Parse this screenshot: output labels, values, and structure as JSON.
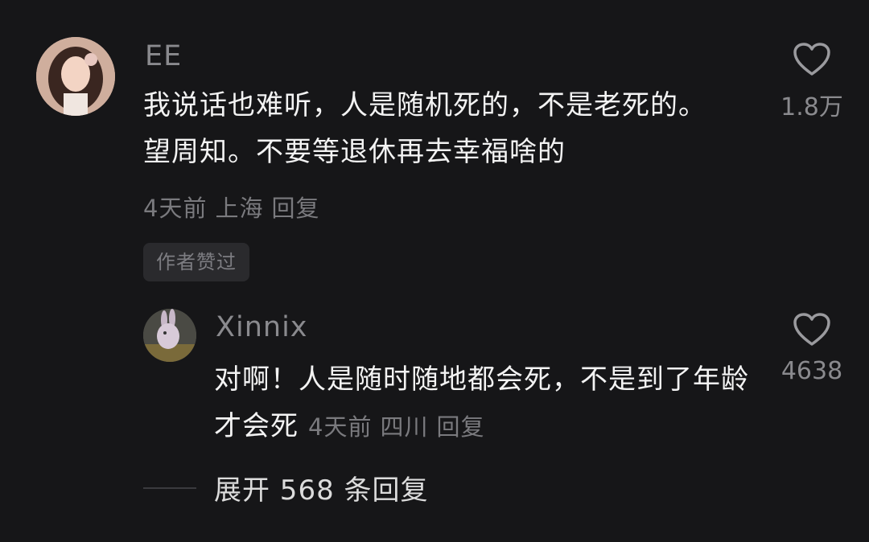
{
  "comment": {
    "author": "EE",
    "text": "我说话也难听，人是随机死的，不是老死的。望周知。不要等退休再去幸福啥的",
    "time": "4天前",
    "location": "上海",
    "reply_label": "回复",
    "badge": "作者赞过",
    "likes": "1.8万"
  },
  "reply": {
    "author": "Xinnix",
    "text": "对啊！人是随时随地都会死，不是到了年龄才会死",
    "time": "4天前",
    "location": "四川",
    "reply_label": "回复",
    "likes": "4638"
  },
  "expand_label": "展开 568 条回复",
  "icons": {
    "like": "heart-icon"
  },
  "colors": {
    "background": "#161618",
    "secondary_text": "#8a8a8e"
  }
}
